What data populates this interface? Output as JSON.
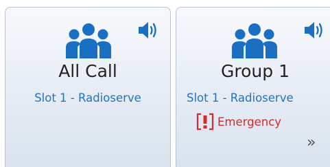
{
  "colors": {
    "accent_blue": "#1f73c6",
    "icon_blue": "#1b6fc2",
    "emergency_red": "#d62a2a",
    "tile_gradient_top": "#f7f9fc",
    "tile_gradient_bottom": "#d9e2ee"
  },
  "tiles": [
    {
      "name": "All Call",
      "slot": "Slot 1 - Radioserve",
      "group_icon": "group-icon",
      "speaker_icon": "speaker-icon"
    },
    {
      "name": "Group 1",
      "slot": "Slot 1 - Radioserve",
      "group_icon": "group-icon",
      "speaker_icon": "speaker-icon",
      "emergency": {
        "badge": "[!]",
        "label": "Emergency"
      },
      "more_icon": "»"
    }
  ]
}
